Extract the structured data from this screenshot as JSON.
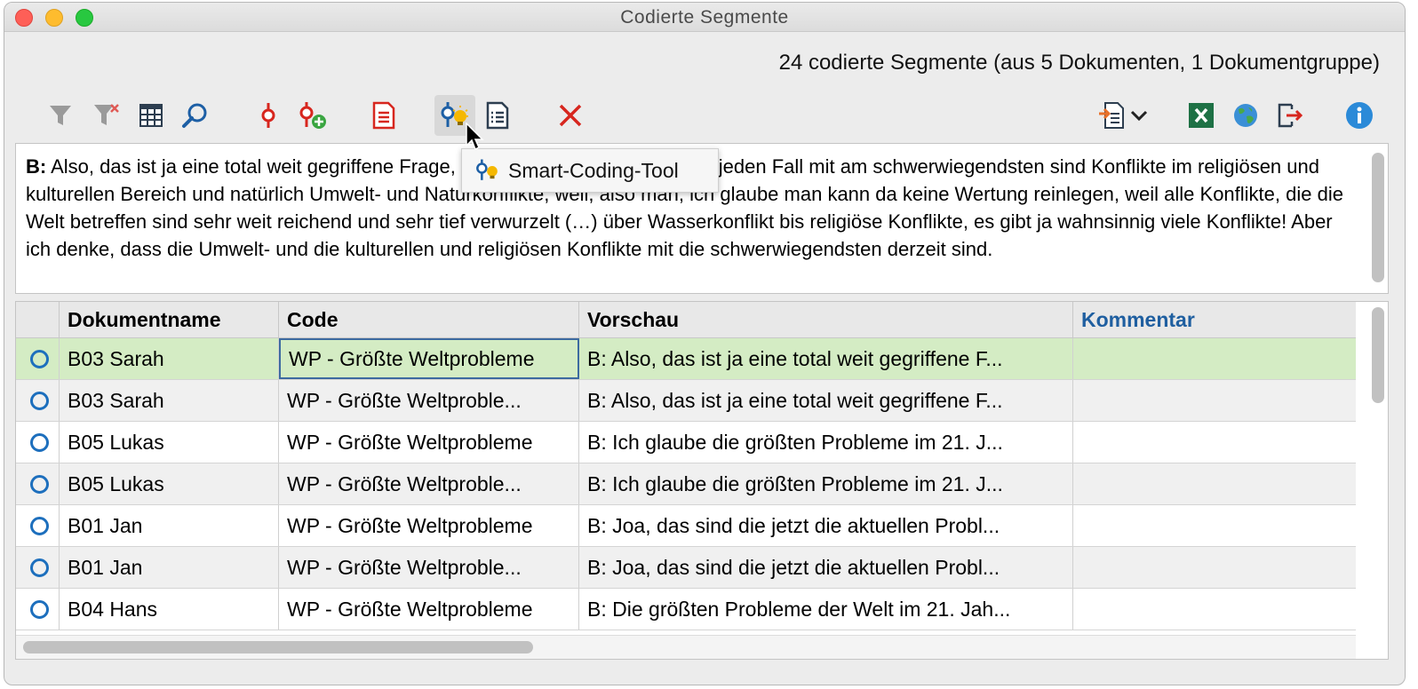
{
  "window": {
    "title": "Codierte Segmente"
  },
  "summary": "24 codierte Segmente (aus 5 Dokumenten, 1 Dokumentgruppe)",
  "toolbar": {
    "icons": [
      "filter-icon",
      "clear-filter-icon",
      "columns-icon",
      "search-icon",
      "code-icon",
      "add-code-icon",
      "document-icon",
      "smart-coding-tool-icon",
      "list-icon",
      "delete-icon",
      "export-icon",
      "dropdown-chevron-icon",
      "excel-icon",
      "globe-icon",
      "exit-icon",
      "info-icon"
    ],
    "tooltip": "Smart-Coding-Tool"
  },
  "segment_text": {
    "speaker": "B:",
    "body": " Also, das ist ja eine total weit gegriffene Frage, weil (…) ich würde sagen auf jeden Fall mit am schwerwiegendsten sind Konflikte im religiösen und kulturellen Bereich und natürlich Umwelt- und Naturkonflikte, weil, also man, ich glaube man kann da keine Wertung reinlegen, weil alle Konflikte, die die Welt betreffen sind sehr weit reichend und sehr tief verwurzelt (…) über Wasserkonflikt bis religiöse Konflikte, es gibt ja wahnsinnig viele Konflikte! Aber ich denke, dass die Umwelt- und die kulturellen und religiösen Konflikte mit die schwerwiegendsten derzeit sind."
  },
  "table": {
    "columns": [
      "",
      "Dokumentname",
      "Code",
      "Vorschau",
      "Kommentar"
    ],
    "rows": [
      {
        "doc": "B03 Sarah",
        "code": "WP - Größte Weltprobleme",
        "preview": "B: Also, das ist ja eine total weit gegriffene F...",
        "comment": ""
      },
      {
        "doc": "B03 Sarah",
        "code": "WP - Größte Weltproble...",
        "preview": "B: Also, das ist ja eine total weit gegriffene F...",
        "comment": ""
      },
      {
        "doc": "B05 Lukas",
        "code": "WP - Größte Weltprobleme",
        "preview": "B: Ich glaube die größten Probleme im 21. J...",
        "comment": ""
      },
      {
        "doc": "B05 Lukas",
        "code": "WP - Größte Weltproble...",
        "preview": "B: Ich glaube die größten Probleme im 21. J...",
        "comment": ""
      },
      {
        "doc": "B01 Jan",
        "code": "WP - Größte Weltprobleme",
        "preview": "B: Joa, das sind die jetzt die aktuellen Probl...",
        "comment": ""
      },
      {
        "doc": "B01 Jan",
        "code": "WP - Größte Weltproble...",
        "preview": "B: Joa, das sind die jetzt die aktuellen Probl...",
        "comment": ""
      },
      {
        "doc": "B04 Hans",
        "code": "WP - Größte Weltprobleme",
        "preview": "B: Die größten Probleme der Welt im 21. Jah...",
        "comment": ""
      }
    ]
  },
  "colors": {
    "selected_row": "#d4ecc4",
    "comment_header": "#1f5fa0",
    "accent_blue": "#1d6fbd",
    "delete_red": "#d7261e"
  }
}
